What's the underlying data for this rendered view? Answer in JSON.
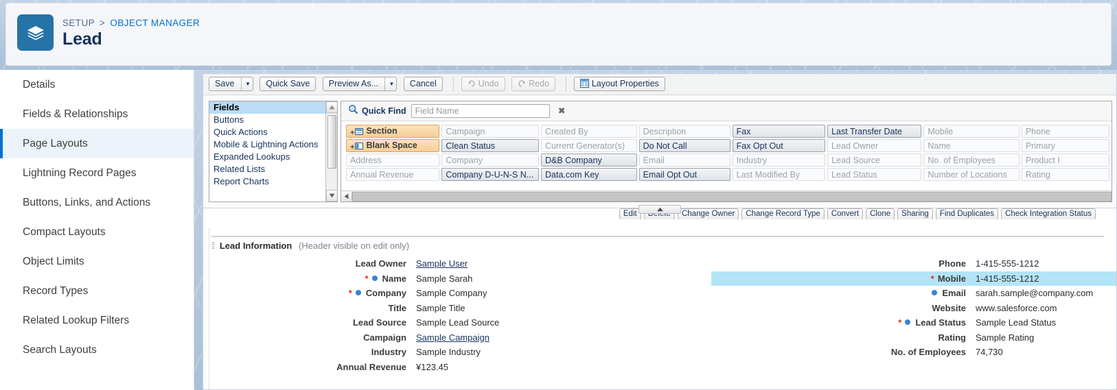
{
  "header": {
    "breadcrumb_setup": "SETUP",
    "breadcrumb_sep": ">",
    "breadcrumb_object": "OBJECT MANAGER",
    "object_title": "Lead",
    "object_icon": "layers-icon",
    "accent_blue": "#0070d2",
    "icon_bg": "#2573a7"
  },
  "sidebar": {
    "items": [
      {
        "label": "Details",
        "active": false
      },
      {
        "label": "Fields & Relationships",
        "active": false
      },
      {
        "label": "Page Layouts",
        "active": true
      },
      {
        "label": "Lightning Record Pages",
        "active": false
      },
      {
        "label": "Buttons, Links, and Actions",
        "active": false
      },
      {
        "label": "Compact Layouts",
        "active": false
      },
      {
        "label": "Object Limits",
        "active": false
      },
      {
        "label": "Record Types",
        "active": false
      },
      {
        "label": "Related Lookup Filters",
        "active": false
      },
      {
        "label": "Search Layouts",
        "active": false
      }
    ]
  },
  "toolbar": {
    "save": "Save",
    "quick_save": "Quick Save",
    "preview_as": "Preview As...",
    "cancel": "Cancel",
    "undo": "Undo",
    "redo": "Redo",
    "layout_properties": "Layout Properties"
  },
  "palette": {
    "categories": [
      {
        "label": "Fields",
        "selected": true
      },
      {
        "label": "Buttons",
        "selected": false
      },
      {
        "label": "Quick Actions",
        "selected": false
      },
      {
        "label": "Mobile & Lightning Actions",
        "selected": false
      },
      {
        "label": "Expanded Lookups",
        "selected": false
      },
      {
        "label": "Related Lists",
        "selected": false
      },
      {
        "label": "Report Charts",
        "selected": false
      }
    ],
    "quick_find_label": "Quick Find",
    "quick_find_placeholder": "Field Name",
    "quick_find_value": "",
    "clear_icon": "close-icon",
    "search_icon": "search-icon",
    "field_rows": [
      [
        {
          "label": "Section",
          "state": "special",
          "icon": "section-icon"
        },
        {
          "label": "Campaign",
          "state": "used"
        },
        {
          "label": "Created By",
          "state": "used"
        },
        {
          "label": "Description",
          "state": "used"
        },
        {
          "label": "Fax",
          "state": "avail"
        },
        {
          "label": "Last Transfer Date",
          "state": "avail"
        },
        {
          "label": "Mobile",
          "state": "used"
        },
        {
          "label": "Phone",
          "state": "used"
        }
      ],
      [
        {
          "label": "Blank Space",
          "state": "special",
          "icon": "blank-space-icon"
        },
        {
          "label": "Clean Status",
          "state": "avail"
        },
        {
          "label": "Current Generator(s)",
          "state": "used"
        },
        {
          "label": "Do Not Call",
          "state": "avail"
        },
        {
          "label": "Fax Opt Out",
          "state": "avail"
        },
        {
          "label": "Lead Owner",
          "state": "used"
        },
        {
          "label": "Name",
          "state": "used"
        },
        {
          "label": "Primary",
          "state": "used"
        }
      ],
      [
        {
          "label": "Address",
          "state": "used"
        },
        {
          "label": "Company",
          "state": "used"
        },
        {
          "label": "D&B Company",
          "state": "avail"
        },
        {
          "label": "Email",
          "state": "used"
        },
        {
          "label": "Industry",
          "state": "used"
        },
        {
          "label": "Lead Source",
          "state": "used"
        },
        {
          "label": "No. of Employees",
          "state": "used"
        },
        {
          "label": "Product I",
          "state": "used"
        }
      ],
      [
        {
          "label": "Annual Revenue",
          "state": "used"
        },
        {
          "label": "Company D-U-N-S N...",
          "state": "avail"
        },
        {
          "label": "Data.com Key",
          "state": "avail"
        },
        {
          "label": "Email Opt Out",
          "state": "avail"
        },
        {
          "label": "Last Modified By",
          "state": "used"
        },
        {
          "label": "Lead Status",
          "state": "used"
        },
        {
          "label": "Number of Locations",
          "state": "used"
        },
        {
          "label": "Rating",
          "state": "used"
        }
      ]
    ]
  },
  "preview": {
    "detail_buttons": [
      "Edit",
      "Delete",
      "Change Owner",
      "Change Record Type",
      "Convert",
      "Clone",
      "Sharing",
      "Find Duplicates",
      "Check Integration Status"
    ],
    "section_title": "Lead Information",
    "section_note": "(Header visible on edit only)",
    "left_fields": [
      {
        "label": "Lead Owner",
        "value": "Sample User",
        "required": false,
        "dot": false,
        "link": true,
        "highlight": false
      },
      {
        "label": "Name",
        "value": "Sample Sarah",
        "required": true,
        "dot": true,
        "link": false,
        "highlight": false
      },
      {
        "label": "Company",
        "value": "Sample Company",
        "required": true,
        "dot": true,
        "link": false,
        "highlight": false
      },
      {
        "label": "Title",
        "value": "Sample Title",
        "required": false,
        "dot": false,
        "link": false,
        "highlight": false
      },
      {
        "label": "Lead Source",
        "value": "Sample Lead Source",
        "required": false,
        "dot": false,
        "link": false,
        "highlight": false
      },
      {
        "label": "Campaign",
        "value": "Sample Campaign",
        "required": false,
        "dot": false,
        "link": true,
        "highlight": false
      },
      {
        "label": "Industry",
        "value": "Sample Industry",
        "required": false,
        "dot": false,
        "link": false,
        "highlight": false
      },
      {
        "label": "Annual Revenue",
        "value": "¥123.45",
        "required": false,
        "dot": false,
        "link": false,
        "highlight": false
      }
    ],
    "right_fields": [
      {
        "label": "Phone",
        "value": "1-415-555-1212",
        "required": false,
        "dot": false,
        "link": false,
        "highlight": false
      },
      {
        "label": "Mobile",
        "value": "1-415-555-1212",
        "required": true,
        "dot": false,
        "link": false,
        "highlight": true
      },
      {
        "label": "Email",
        "value": "sarah.sample@company.com",
        "required": false,
        "dot": true,
        "link": false,
        "highlight": false
      },
      {
        "label": "Website",
        "value": "www.salesforce.com",
        "required": false,
        "dot": false,
        "link": false,
        "highlight": false
      },
      {
        "label": "Lead Status",
        "value": "Sample Lead Status",
        "required": true,
        "dot": true,
        "link": false,
        "highlight": false
      },
      {
        "label": "Rating",
        "value": "Sample Rating",
        "required": false,
        "dot": false,
        "link": false,
        "highlight": false
      },
      {
        "label": "No. of Employees",
        "value": "74,730",
        "required": false,
        "dot": false,
        "link": false,
        "highlight": false
      }
    ],
    "highlight_color": "#b3e4f7",
    "required_color": "#e02f2f"
  }
}
